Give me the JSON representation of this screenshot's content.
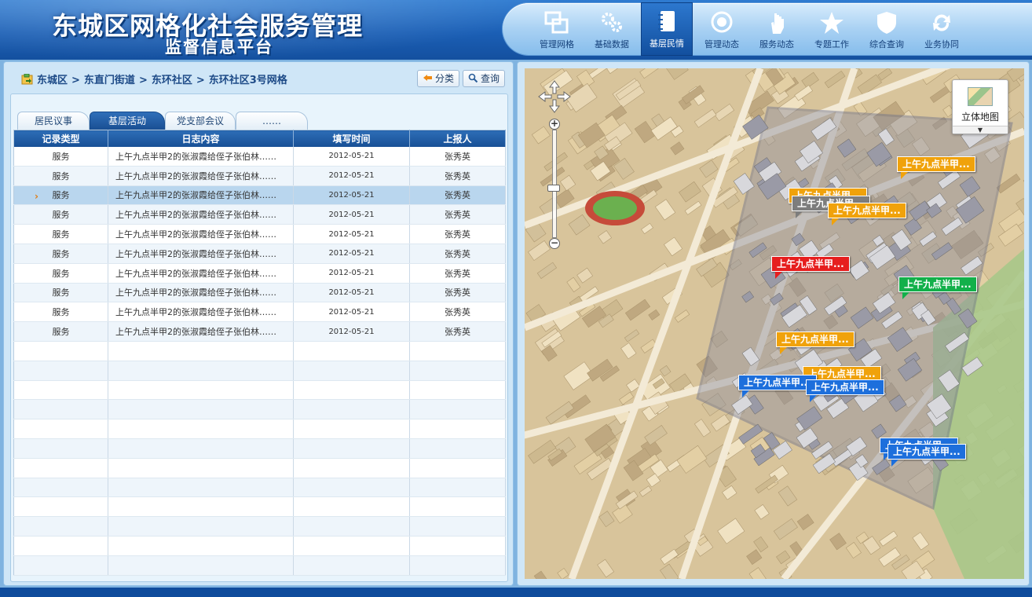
{
  "header": {
    "title_line1": "东城区网格化社会服务管理",
    "title_line2": "监督信息平台"
  },
  "nav": {
    "items": [
      {
        "label": "管理网格",
        "icon": "grid-icon"
      },
      {
        "label": "基础数据",
        "icon": "gears-icon"
      },
      {
        "label": "基层民情",
        "icon": "notebook-icon",
        "active": true
      },
      {
        "label": "管理动态",
        "icon": "compass-icon"
      },
      {
        "label": "服务动态",
        "icon": "hand-icon"
      },
      {
        "label": "专题工作",
        "icon": "star-icon"
      },
      {
        "label": "综合查询",
        "icon": "shield-icon"
      },
      {
        "label": "业务协同",
        "icon": "sync-icon"
      }
    ]
  },
  "breadcrumb": [
    "东城区",
    "东直门街道",
    "东环社区",
    "东环社区3号网格"
  ],
  "breadcrumb_sep": ">",
  "toolbar": {
    "classify_label": "分类",
    "query_label": "查询"
  },
  "tabs": [
    {
      "label": "居民议事"
    },
    {
      "label": "基层活动",
      "active": true
    },
    {
      "label": "党支部会议"
    },
    {
      "label": "……"
    }
  ],
  "table": {
    "columns": [
      "记录类型",
      "日志内容",
      "填写时间",
      "上报人"
    ],
    "rows": [
      [
        "服务",
        "上午九点半甲2的张淑霞给侄子张伯林……",
        "2012-05-21",
        "张秀英"
      ],
      [
        "服务",
        "上午九点半甲2的张淑霞给侄子张伯林……",
        "2012-05-21",
        "张秀英"
      ],
      [
        "服务",
        "上午九点半甲2的张淑霞给侄子张伯林……",
        "2012-05-21",
        "张秀英"
      ],
      [
        "服务",
        "上午九点半甲2的张淑霞给侄子张伯林……",
        "2012-05-21",
        "张秀英"
      ],
      [
        "服务",
        "上午九点半甲2的张淑霞给侄子张伯林……",
        "2012-05-21",
        "张秀英"
      ],
      [
        "服务",
        "上午九点半甲2的张淑霞给侄子张伯林……",
        "2012-05-21",
        "张秀英"
      ],
      [
        "服务",
        "上午九点半甲2的张淑霞给侄子张伯林……",
        "2012-05-21",
        "张秀英"
      ],
      [
        "服务",
        "上午九点半甲2的张淑霞给侄子张伯林……",
        "2012-05-21",
        "张秀英"
      ],
      [
        "服务",
        "上午九点半甲2的张淑霞给侄子张伯林……",
        "2012-05-21",
        "张秀英"
      ],
      [
        "服务",
        "上午九点半甲2的张淑霞给侄子张伯林……",
        "2012-05-21",
        "张秀英"
      ]
    ],
    "selected_row": 2
  },
  "map": {
    "mode_label": "立体地图",
    "markers": [
      {
        "label": "上午九点半甲...",
        "color": "orange"
      },
      {
        "label": "上午九点半甲...",
        "color": "orange"
      },
      {
        "label": "上午九点半甲...",
        "color": "gray"
      },
      {
        "label": "上午九点半甲...",
        "color": "orange"
      },
      {
        "label": "上午九点半甲...",
        "color": "red"
      },
      {
        "label": "上午九点半甲...",
        "color": "green"
      },
      {
        "label": "上午九点半甲...",
        "color": "orange"
      },
      {
        "label": "上午九点半甲...",
        "color": "orange"
      },
      {
        "label": "上午九点半甲...",
        "color": "blue"
      },
      {
        "label": "上午九点半甲...",
        "color": "blue"
      },
      {
        "label": "上午九点半甲...",
        "color": "blue"
      },
      {
        "label": "上午九点半甲...",
        "color": "blue"
      }
    ]
  }
}
